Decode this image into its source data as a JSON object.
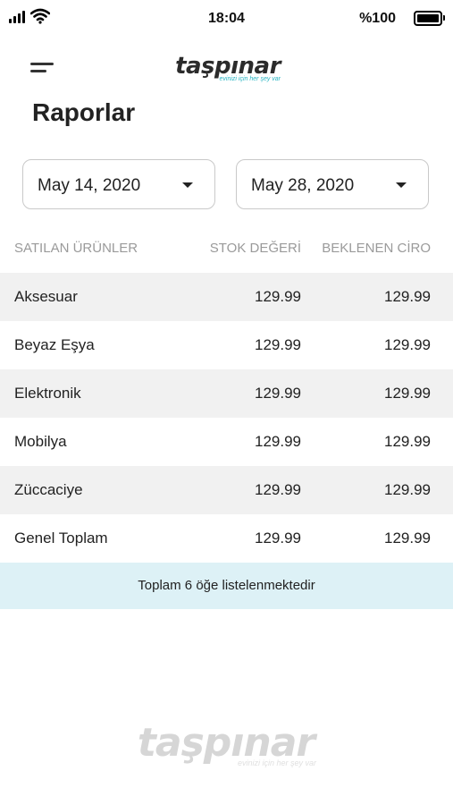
{
  "status_bar": {
    "time": "18:04",
    "battery": "%100",
    "icons": [
      "signal-icon",
      "wifi-icon",
      "battery-icon"
    ]
  },
  "header": {
    "menu_icon": "hamburger-menu-icon",
    "logo_text": "taşpınar",
    "logo_tagline": "evinizi için her şey var"
  },
  "page": {
    "title": "Raporlar"
  },
  "filters": {
    "start_date": "May 14, 2020",
    "end_date": "May 28, 2020",
    "dropdown_icon": "caret-down-icon"
  },
  "table": {
    "columns": [
      "SATILAN ÜRÜNLER",
      "STOK DEĞERİ",
      "BEKLENEN CİRO"
    ],
    "rows": [
      {
        "name": "Aksesuar",
        "stock": "129.99",
        "revenue": "129.99"
      },
      {
        "name": "Beyaz Eşya",
        "stock": "129.99",
        "revenue": "129.99"
      },
      {
        "name": "Elektronik",
        "stock": "129.99",
        "revenue": "129.99"
      },
      {
        "name": "Mobilya",
        "stock": "129.99",
        "revenue": "129.99"
      },
      {
        "name": "Züccaciye",
        "stock": "129.99",
        "revenue": "129.99"
      },
      {
        "name": "Genel Toplam",
        "stock": "129.99",
        "revenue": "129.99"
      }
    ],
    "summary": "Toplam 6 öğe listelenmektedir"
  },
  "footer": {
    "watermark_text": "taşpınar",
    "watermark_tagline": "evinizi için her şey var"
  },
  "colors": {
    "accent": "#27b4c2",
    "summary_bg": "#ddf1f6",
    "row_shade": "#f1f1f1",
    "header_text": "#9a9a9a"
  }
}
